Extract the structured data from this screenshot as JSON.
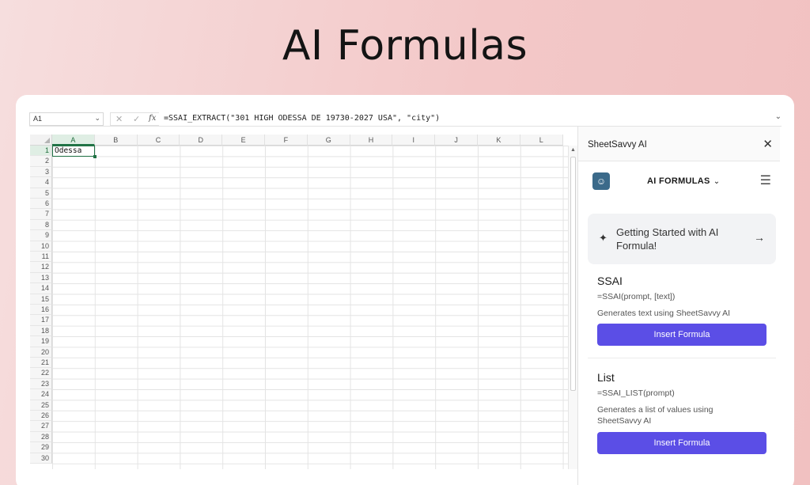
{
  "hero": {
    "title": "AI Formulas"
  },
  "formula_bar": {
    "cell_ref": "A1",
    "cancel_icon": "✕",
    "confirm_icon": "✓",
    "fx_label": "fx",
    "formula": "=SSAI_EXTRACT(\"301 HIGH ODESSA DE 19730-2027 USA\", \"city\")"
  },
  "sheet": {
    "columns": [
      "A",
      "B",
      "C",
      "D",
      "E",
      "F",
      "G",
      "H",
      "I",
      "J",
      "K",
      "L"
    ],
    "rows": [
      "1",
      "2",
      "3",
      "4",
      "5",
      "6",
      "7",
      "8",
      "9",
      "10",
      "11",
      "12",
      "13",
      "14",
      "15",
      "16",
      "17",
      "18",
      "19",
      "20",
      "21",
      "22",
      "23",
      "24",
      "25",
      "26",
      "27",
      "28",
      "29",
      "30"
    ],
    "active_cell_value": "Odessa"
  },
  "panel": {
    "title": "SheetSavvy AI",
    "mode_label": "AI FORMULAS",
    "getting_started": "Getting Started with AI Formula!",
    "formulas": [
      {
        "name": "SSAI",
        "syntax": "=SSAI(prompt, [text])",
        "description": "Generates text using SheetSavvy AI",
        "button": "Insert Formula"
      },
      {
        "name": "List",
        "syntax": "=SSAI_LIST(prompt)",
        "description": "Generates a list of values using SheetSavvy AI",
        "button": "Insert Formula"
      }
    ]
  },
  "colors": {
    "accent": "#5b4ee6",
    "excel_green": "#217346"
  }
}
